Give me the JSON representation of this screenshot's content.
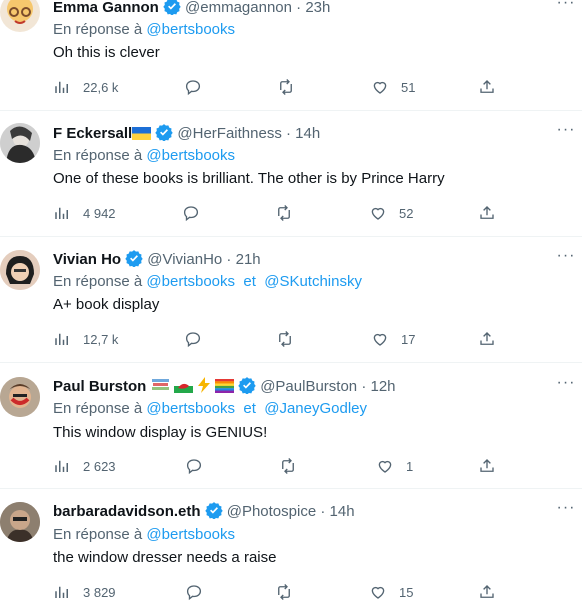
{
  "reply_prefix": "En réponse à",
  "and_word": "et",
  "icons": {
    "views": "bar-chart-icon",
    "reply": "speech-bubble-icon",
    "retweet": "retweet-arrows-icon",
    "like": "heart-icon",
    "share": "share-upload-icon",
    "verified": "verified-badge-icon",
    "more": "more-dots-icon"
  },
  "colors": {
    "accent": "#1d9bf0",
    "muted": "#536471",
    "text": "#0f1419",
    "divider": "#eff3f4"
  },
  "tweets": [
    {
      "name": "Emma Gannon",
      "handle": "@emmagannon",
      "time": "23h",
      "reply_to": [
        "@bertsbooks"
      ],
      "text": "Oh this is clever",
      "views": "22,6 k",
      "replies": "",
      "retweets": "",
      "likes": "51"
    },
    {
      "name": "F Eckersall",
      "handle": "@HerFaithness",
      "time": "14h",
      "reply_to": [
        "@bertsbooks"
      ],
      "text": "One of these books is brilliant. The other is by Prince Harry",
      "views": "4 942",
      "replies": "",
      "retweets": "",
      "likes": "52"
    },
    {
      "name": "Vivian Ho",
      "handle": "@VivianHo",
      "time": "21h",
      "reply_to": [
        "@bertsbooks",
        "@SKutchinsky"
      ],
      "text": "A+ book display",
      "views": "12,7 k",
      "replies": "",
      "retweets": "",
      "likes": "17"
    },
    {
      "name": "Paul Burston",
      "handle": "@PaulBurston",
      "time": "12h",
      "reply_to": [
        "@bertsbooks",
        "@JaneyGodley"
      ],
      "text": "This window display is GENIUS!",
      "views": "2 623",
      "replies": "",
      "retweets": "",
      "likes": "1"
    },
    {
      "name": "barbaradavidson.eth",
      "handle": "@Photospice",
      "time": "14h",
      "reply_to": [
        "@bertsbooks"
      ],
      "text": "the window dresser needs a raise",
      "views": "3 829",
      "replies": "",
      "retweets": "",
      "likes": "15"
    }
  ]
}
